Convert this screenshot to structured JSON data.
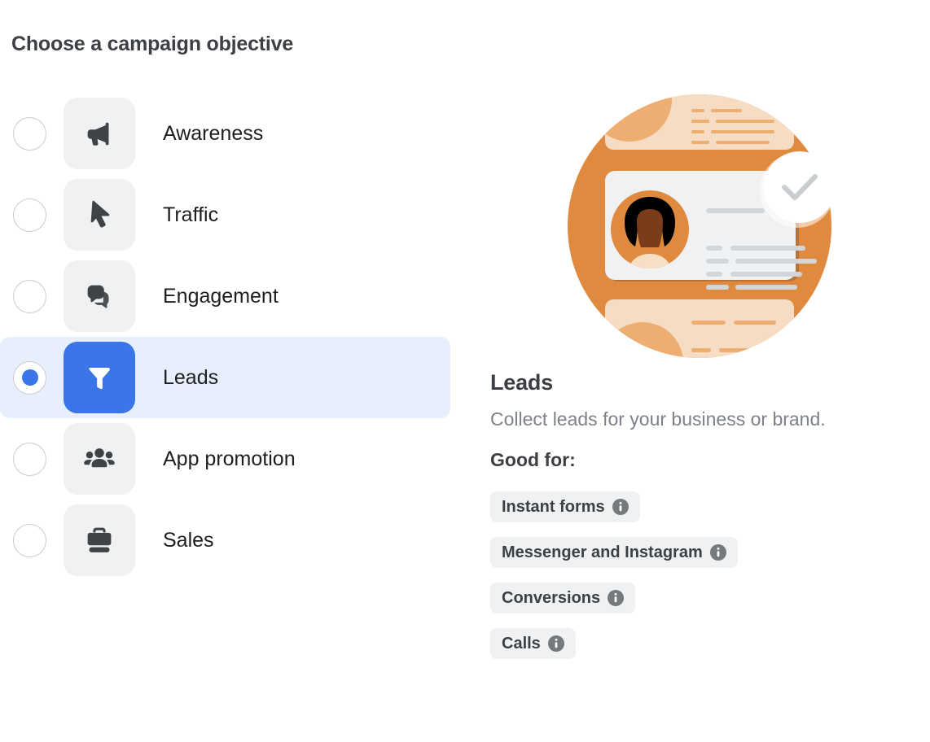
{
  "page_title": "Choose a campaign objective",
  "colors": {
    "selected_row_bg": "#e7effd",
    "selected_tile_bg": "#3b76e8",
    "tile_bg": "#f0f1f3",
    "chip_bg": "#f0f1f3",
    "illustration_orange": "#e08a3f",
    "illustration_peach": "#f5dcc2"
  },
  "objectives": [
    {
      "id": "awareness",
      "label": "Awareness",
      "icon": "megaphone-icon",
      "selected": false
    },
    {
      "id": "traffic",
      "label": "Traffic",
      "icon": "cursor-icon",
      "selected": false
    },
    {
      "id": "engagement",
      "label": "Engagement",
      "icon": "chat-bubbles-icon",
      "selected": false
    },
    {
      "id": "leads",
      "label": "Leads",
      "icon": "funnel-icon",
      "selected": true
    },
    {
      "id": "app-promotion",
      "label": "App promotion",
      "icon": "people-icon",
      "selected": false
    },
    {
      "id": "sales",
      "label": "Sales",
      "icon": "briefcase-icon",
      "selected": false
    }
  ],
  "detail": {
    "illustration": "lead-form-card-illustration",
    "title": "Leads",
    "description": "Collect leads for your business or brand.",
    "good_for_label": "Good for:",
    "chips": [
      {
        "label": "Instant forms",
        "icon": "info-icon"
      },
      {
        "label": "Messenger and Instagram",
        "icon": "info-icon"
      },
      {
        "label": "Conversions",
        "icon": "info-icon"
      },
      {
        "label": "Calls",
        "icon": "info-icon"
      }
    ]
  }
}
